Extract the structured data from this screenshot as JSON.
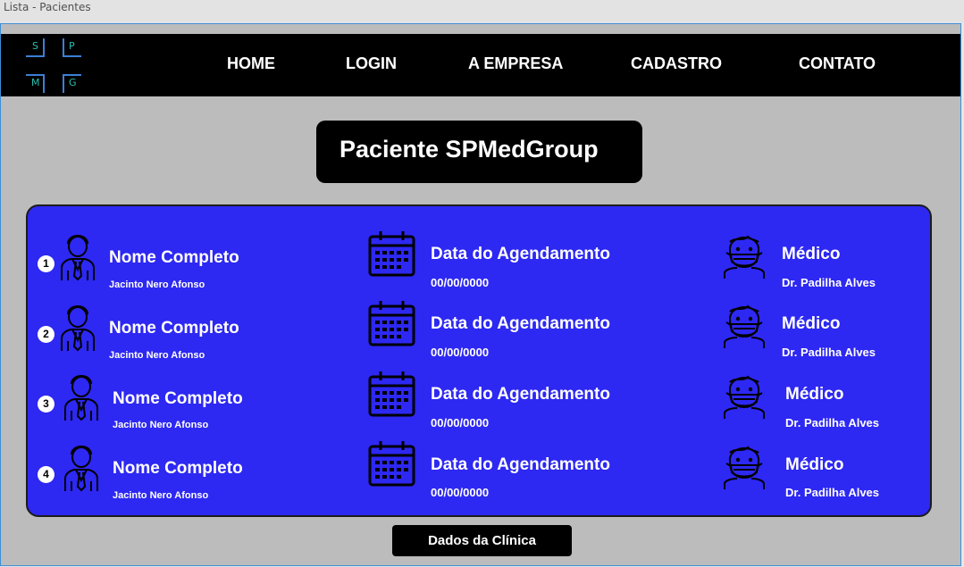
{
  "window": {
    "title": "Lista - Pacientes"
  },
  "logo": {
    "letters": [
      "S",
      "P",
      "M",
      "G"
    ]
  },
  "nav": {
    "items": [
      "HOME",
      "LOGIN",
      "A EMPRESA",
      "CADASTRO",
      "CONTATO"
    ]
  },
  "page_title": "Paciente SPMedGroup",
  "rows": [
    {
      "number": "1",
      "name_label": "Nome Completo",
      "name_value": "Jacinto Nero Afonso",
      "date_label": "Data do Agendamento",
      "date_value": "00/00/0000",
      "doctor_label": "Médico",
      "doctor_value": "Dr. Padilha Alves"
    },
    {
      "number": "2",
      "name_label": "Nome Completo",
      "name_value": "Jacinto Nero Afonso",
      "date_label": "Data do Agendamento",
      "date_value": "00/00/0000",
      "doctor_label": "Médico",
      "doctor_value": "Dr. Padilha Alves"
    },
    {
      "number": "3",
      "name_label": "Nome Completo",
      "name_value": "Jacinto Nero Afonso",
      "date_label": "Data do Agendamento",
      "date_value": "00/00/0000",
      "doctor_label": "Médico",
      "doctor_value": "Dr. Padilha Alves"
    },
    {
      "number": "4",
      "name_label": "Nome Completo",
      "name_value": "Jacinto Nero Afonso",
      "date_label": "Data do Agendamento",
      "date_value": "00/00/0000",
      "doctor_label": "Médico",
      "doctor_value": "Dr. Padilha Alves"
    }
  ],
  "footer": {
    "button_label": "Dados da Clínica"
  },
  "icons": {
    "patient": "businessman-icon",
    "date": "calendar-icon",
    "doctor": "doctor-mask-icon"
  },
  "colors": {
    "panel": "#2d28f2",
    "nav": "#000000",
    "background": "#bcbcbc",
    "accent": "#3d7fd6"
  }
}
